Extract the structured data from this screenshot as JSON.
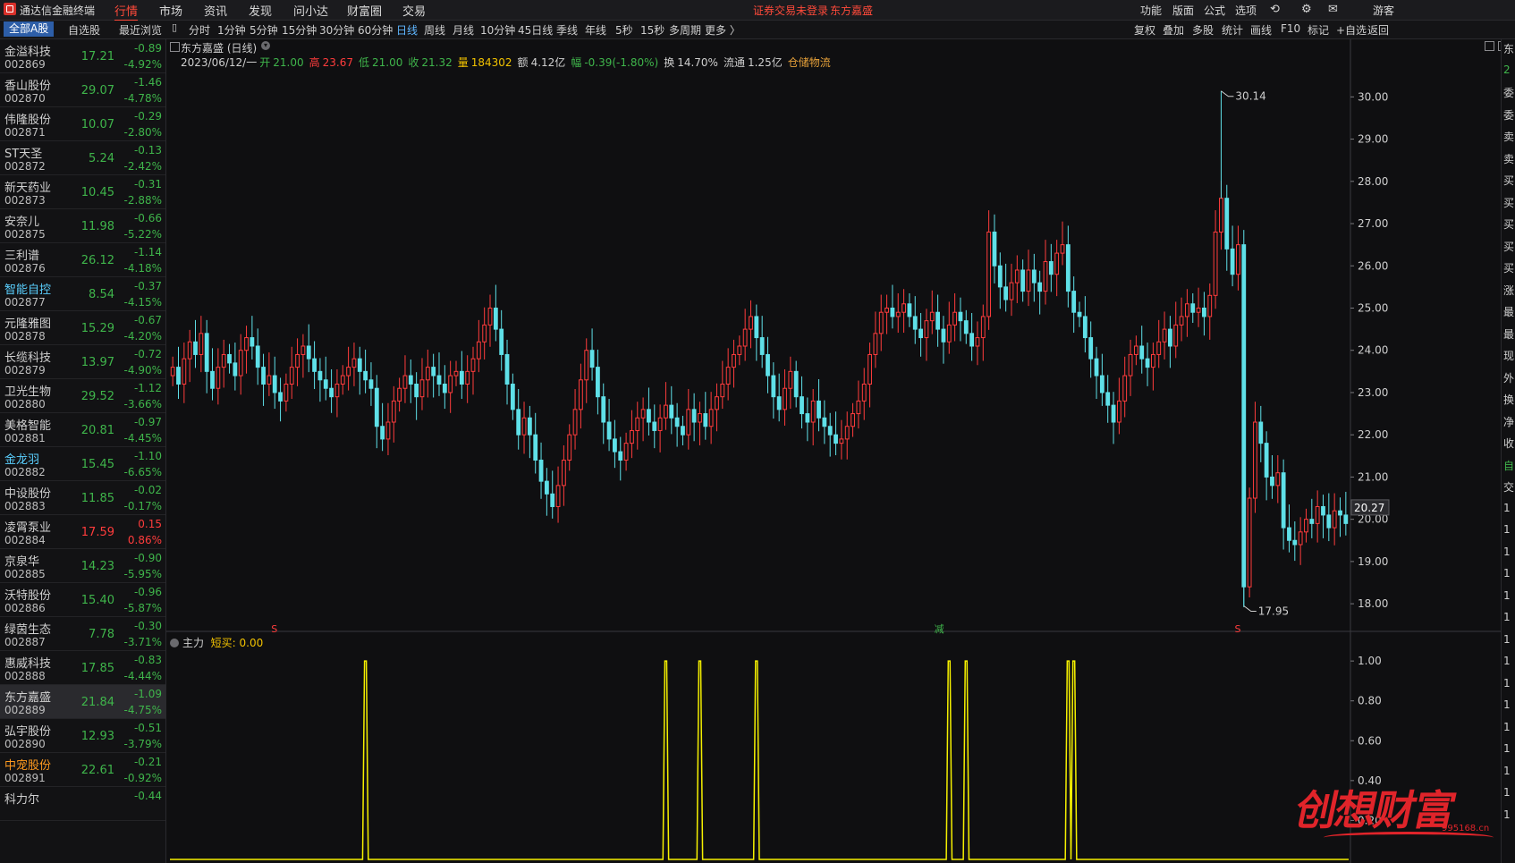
{
  "app": {
    "title": "通达信金融终端"
  },
  "menu": [
    "行情",
    "市场",
    "资讯",
    "发现",
    "问小达",
    "财富圈",
    "交易"
  ],
  "notice": "证券交易未登录",
  "notice_stock": "东方嘉盛",
  "tools": [
    "功能",
    "版面",
    "公式",
    "选项"
  ],
  "user": "游客",
  "sidebar_tabs": [
    "全部A股",
    "自选股",
    "最近浏览"
  ],
  "periods": [
    "分时",
    "1分钟",
    "5分钟",
    "15分钟",
    "30分钟",
    "60分钟",
    "日线",
    "周线",
    "月线",
    "10分钟",
    "45日线",
    "季线",
    "年线",
    "5秒",
    "15秒",
    "多周期",
    "更多 〉"
  ],
  "active_period": "日线",
  "right_tools": [
    "复权",
    "叠加",
    "多股",
    "统计",
    "画线",
    "F10",
    "标记",
    "+自选",
    "返回"
  ],
  "stocks": [
    {
      "name": "金溢科技",
      "code": "002869",
      "price": "17.21",
      "chg": "-0.89",
      "pct": "-4.92%",
      "dir": "dn",
      "name_color": "w"
    },
    {
      "name": "香山股份",
      "code": "002870",
      "price": "29.07",
      "chg": "-1.46",
      "pct": "-4.78%",
      "dir": "dn",
      "name_color": "w"
    },
    {
      "name": "伟隆股份",
      "code": "002871",
      "price": "10.07",
      "chg": "-0.29",
      "pct": "-2.80%",
      "dir": "dn",
      "name_color": "w"
    },
    {
      "name": "ST天圣",
      "code": "002872",
      "price": "5.24",
      "chg": "-0.13",
      "pct": "-2.42%",
      "dir": "dn",
      "name_color": "w"
    },
    {
      "name": "新天药业",
      "code": "002873",
      "price": "10.45",
      "chg": "-0.31",
      "pct": "-2.88%",
      "dir": "dn",
      "name_color": "w"
    },
    {
      "name": "安奈儿",
      "code": "002875",
      "price": "11.98",
      "chg": "-0.66",
      "pct": "-5.22%",
      "dir": "dn",
      "name_color": "w"
    },
    {
      "name": "三利谱",
      "code": "002876",
      "price": "26.12",
      "chg": "-1.14",
      "pct": "-4.18%",
      "dir": "dn",
      "name_color": "w"
    },
    {
      "name": "智能自控",
      "code": "002877",
      "price": "8.54",
      "chg": "-0.37",
      "pct": "-4.15%",
      "dir": "dn",
      "name_color": "cy"
    },
    {
      "name": "元隆雅图",
      "code": "002878",
      "price": "15.29",
      "chg": "-0.67",
      "pct": "-4.20%",
      "dir": "dn",
      "name_color": "w"
    },
    {
      "name": "长缆科技",
      "code": "002879",
      "price": "13.97",
      "chg": "-0.72",
      "pct": "-4.90%",
      "dir": "dn",
      "name_color": "w"
    },
    {
      "name": "卫光生物",
      "code": "002880",
      "price": "29.52",
      "chg": "-1.12",
      "pct": "-3.66%",
      "dir": "dn",
      "name_color": "w"
    },
    {
      "name": "美格智能",
      "code": "002881",
      "price": "20.81",
      "chg": "-0.97",
      "pct": "-4.45%",
      "dir": "dn",
      "name_color": "w"
    },
    {
      "name": "金龙羽",
      "code": "002882",
      "price": "15.45",
      "chg": "-1.10",
      "pct": "-6.65%",
      "dir": "dn",
      "name_color": "cy"
    },
    {
      "name": "中设股份",
      "code": "002883",
      "price": "11.85",
      "chg": "-0.02",
      "pct": "-0.17%",
      "dir": "dn",
      "name_color": "w"
    },
    {
      "name": "凌霄泵业",
      "code": "002884",
      "price": "17.59",
      "chg": "0.15",
      "pct": "0.86%",
      "dir": "up",
      "name_color": "w"
    },
    {
      "name": "京泉华",
      "code": "002885",
      "price": "14.23",
      "chg": "-0.90",
      "pct": "-5.95%",
      "dir": "dn",
      "name_color": "w"
    },
    {
      "name": "沃特股份",
      "code": "002886",
      "price": "15.40",
      "chg": "-0.96",
      "pct": "-5.87%",
      "dir": "dn",
      "name_color": "w"
    },
    {
      "name": "绿茵生态",
      "code": "002887",
      "price": "7.78",
      "chg": "-0.30",
      "pct": "-3.71%",
      "dir": "dn",
      "name_color": "w"
    },
    {
      "name": "惠威科技",
      "code": "002888",
      "price": "17.85",
      "chg": "-0.83",
      "pct": "-4.44%",
      "dir": "dn",
      "name_color": "w"
    },
    {
      "name": "东方嘉盛",
      "code": "002889",
      "price": "21.84",
      "chg": "-1.09",
      "pct": "-4.75%",
      "dir": "dn",
      "name_color": "w",
      "selected": true
    },
    {
      "name": "弘宇股份",
      "code": "002890",
      "price": "12.93",
      "chg": "-0.51",
      "pct": "-3.79%",
      "dir": "dn",
      "name_color": "w"
    },
    {
      "name": "中宠股份",
      "code": "002891",
      "price": "22.61",
      "chg": "-0.21",
      "pct": "-0.92%",
      "dir": "dn",
      "name_color": "og"
    },
    {
      "name": "科力尔",
      "code": "",
      "price": "",
      "chg": "-0.44",
      "pct": "",
      "dir": "dn",
      "name_color": "w"
    }
  ],
  "chart_title": "东方嘉盛 (日线)",
  "info": {
    "date": "2023/06/12/一",
    "open_label": "开",
    "open": "21.00",
    "high_label": "高",
    "high": "23.67",
    "low_label": "低",
    "low": "21.00",
    "close_label": "收",
    "close": "21.32",
    "vol_label": "量",
    "vol": "184302",
    "amt_label": "额",
    "amt": "4.12亿",
    "range_label": "幅",
    "range": "-0.39(-1.80%)",
    "turn_label": "换",
    "turn": "14.70%",
    "float_label": "流通",
    "float": "1.25亿",
    "sector": "仓储物流"
  },
  "indicator": {
    "name": "主力",
    "label": "短买:",
    "value": "0.00"
  },
  "right_chars": [
    "东",
    "2",
    "委",
    "委",
    "卖",
    "卖",
    "买",
    "买",
    "买",
    "买",
    "买",
    "涨",
    "最",
    "最",
    "现",
    "外",
    "换",
    "净",
    "收",
    "自",
    "交",
    "1",
    "1",
    "1",
    "1",
    "1",
    "1",
    "1",
    "1",
    "1",
    "1",
    "1",
    "1",
    "1",
    "1",
    "1"
  ],
  "watermark": {
    "text": "创想财富",
    "url": "995168.cn"
  },
  "colors": {
    "up": "#ff3c3c",
    "down": "#5fe0e8",
    "indicator": "#f5f000",
    "grid": "#2c2c30",
    "marker_s": "#ff3c3c",
    "marker_z": "#3fb54b"
  },
  "chart_data": {
    "type": "candlestick",
    "ylim": [
      17.6,
      30.6
    ],
    "yticks": [
      18.0,
      19.0,
      20.0,
      21.0,
      22.0,
      23.0,
      24.0,
      25.0,
      26.0,
      27.0,
      28.0,
      29.0,
      30.0
    ],
    "ytick_labels": [
      "18.00",
      "19.00",
      "20.00",
      "21.00",
      "22.00",
      "23.00",
      "24.00",
      "25.00",
      "26.00",
      "27.00",
      "28.00",
      "29.00",
      "30.00"
    ],
    "annotations": {
      "high": "30.14",
      "low": "17.95",
      "current": "20.27"
    },
    "markers": [
      {
        "text": "S",
        "index": 18
      },
      {
        "text": "减",
        "index": 135
      },
      {
        "text": "S",
        "index": 188
      }
    ],
    "closes": [
      23.6,
      23.2,
      23.8,
      24.2,
      23.9,
      24.4,
      23.5,
      23.1,
      23.6,
      23.9,
      23.7,
      23.4,
      24.0,
      24.3,
      24.1,
      23.6,
      23.2,
      23.4,
      23.0,
      22.8,
      23.2,
      23.6,
      23.9,
      24.1,
      23.8,
      23.5,
      23.3,
      23.1,
      22.9,
      23.2,
      23.4,
      23.6,
      23.8,
      23.5,
      23.3,
      23.1,
      22.2,
      21.9,
      22.3,
      22.8,
      23.1,
      23.4,
      23.2,
      22.9,
      23.3,
      23.6,
      23.4,
      23.2,
      23.0,
      23.4,
      23.5,
      23.2,
      23.5,
      23.8,
      24.2,
      24.6,
      25.0,
      24.5,
      23.9,
      23.2,
      22.6,
      22.0,
      22.4,
      22.0,
      21.4,
      20.9,
      20.6,
      20.3,
      20.8,
      21.4,
      22.0,
      22.6,
      23.3,
      24.0,
      23.6,
      22.9,
      22.3,
      21.9,
      21.6,
      21.4,
      21.8,
      22.1,
      22.4,
      22.6,
      22.3,
      22.1,
      22.4,
      22.7,
      22.4,
      22.2,
      22.0,
      22.6,
      22.3,
      22.5,
      22.2,
      22.6,
      22.9,
      23.2,
      23.6,
      23.9,
      24.1,
      24.5,
      24.8,
      24.3,
      23.9,
      23.4,
      22.9,
      22.6,
      23.1,
      23.5,
      22.9,
      22.5,
      22.3,
      22.8,
      22.4,
      22.2,
      22.0,
      21.8,
      21.9,
      22.2,
      22.5,
      22.8,
      23.2,
      23.9,
      24.4,
      24.9,
      25.0,
      24.8,
      24.9,
      25.1,
      24.8,
      24.5,
      24.3,
      24.7,
      24.9,
      24.5,
      24.2,
      24.6,
      24.9,
      24.7,
      24.4,
      24.1,
      24.3,
      24.8,
      26.8,
      26.0,
      25.5,
      25.2,
      25.6,
      25.9,
      25.4,
      25.9,
      25.6,
      25.4,
      26.1,
      25.8,
      26.3,
      26.5,
      25.4,
      24.9,
      24.8,
      24.3,
      23.8,
      23.4,
      23.0,
      22.7,
      22.3,
      22.8,
      23.4,
      23.9,
      24.1,
      23.8,
      23.6,
      23.9,
      24.2,
      24.5,
      24.1,
      24.6,
      24.8,
      25.1,
      24.9,
      25.0,
      24.8,
      25.3,
      26.8,
      27.6,
      26.4,
      25.8,
      26.5,
      18.4,
      20.5,
      22.3,
      21.8,
      21.0,
      20.8,
      21.1,
      19.8,
      19.5,
      19.4,
      19.7,
      20.0,
      19.9,
      20.3,
      20.1,
      19.8,
      20.2,
      20.1,
      19.9
    ],
    "indicator": {
      "name": "主力",
      "ylim": [
        0,
        1.05
      ],
      "yticks": [
        0.2,
        0.4,
        0.6,
        0.8,
        1.0
      ],
      "ytick_labels": [
        "0.20",
        "0.40",
        "0.60",
        "0.80",
        "1.00"
      ],
      "spikes": [
        34,
        87,
        93,
        103,
        137,
        140,
        158,
        159
      ]
    }
  }
}
